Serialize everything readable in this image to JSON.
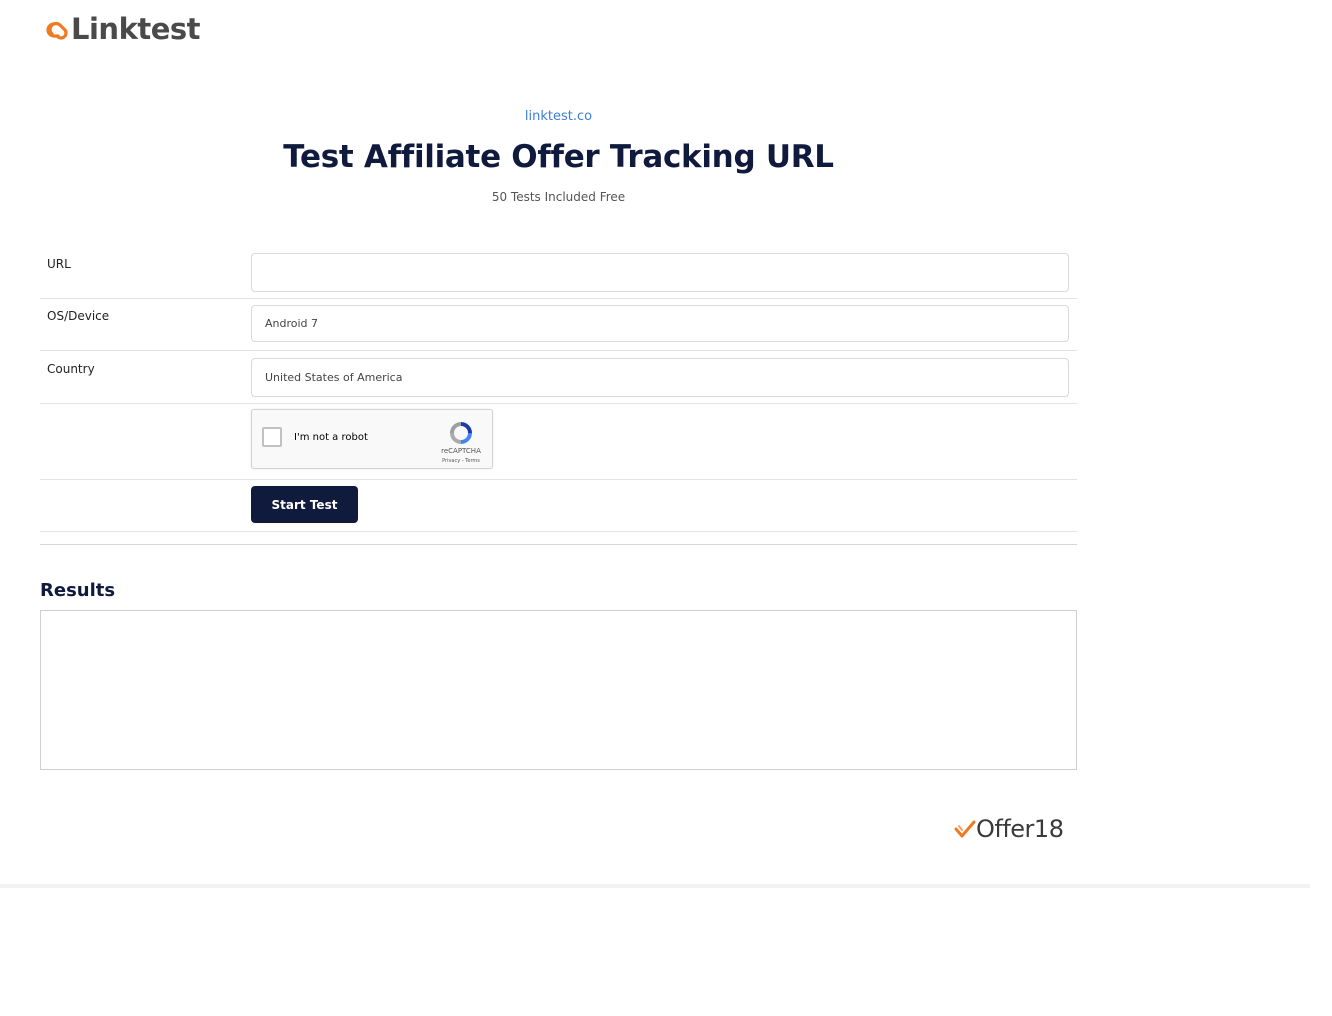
{
  "header": {
    "logo_text": "Linktest",
    "logo_icon": "chain-link-icon"
  },
  "hero": {
    "site_link": "linktest.co",
    "title": "Test Affiliate Offer Tracking URL",
    "subtitle": "50 Tests Included Free"
  },
  "form": {
    "url_label": "URL",
    "url_value": "",
    "os_label": "OS/Device",
    "os_value": "Android 7",
    "country_label": "Country",
    "country_value": "United States of America",
    "captcha": {
      "label": "I'm not a robot",
      "brand": "reCAPTCHA",
      "links": "Privacy - Terms",
      "checked": false
    },
    "submit_label": "Start Test"
  },
  "results": {
    "title": "Results",
    "content": ""
  },
  "footer": {
    "partner_logo_text": "Offer18",
    "partner_icon": "checkmark-icon"
  },
  "colors": {
    "brand_navy": "#0f1a3d",
    "logo_orange": "#f07a22",
    "link_blue": "#3d7fd6"
  }
}
